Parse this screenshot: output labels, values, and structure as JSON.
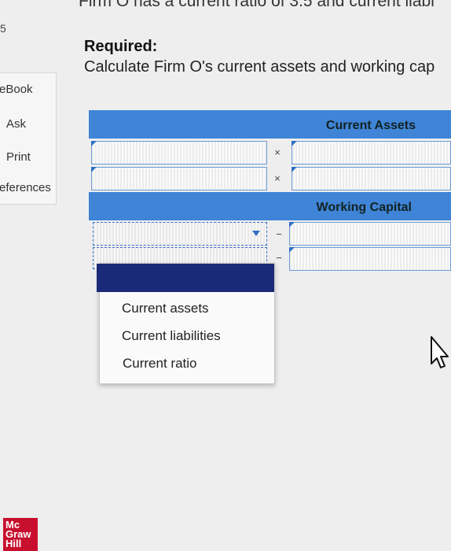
{
  "header": {
    "top_text": "Firm O has a current ratio of 3.5 and current liabi"
  },
  "nav": {
    "marker": "5",
    "items": [
      "eBook",
      "Ask",
      "Print",
      "eferences"
    ]
  },
  "content": {
    "required_label": "Required:",
    "question": "Calculate Firm O's current assets and working cap"
  },
  "table": {
    "current_assets_header": "Current Assets",
    "working_capital_header": "Working Capital",
    "operator_multiply": "×",
    "operator_minus": "−"
  },
  "dropdown": {
    "options": [
      "Current assets",
      "Current liabilities",
      "Current ratio"
    ]
  },
  "branding": {
    "logo_lines": [
      "Mc",
      "Graw",
      "Hill"
    ]
  },
  "colors": {
    "header_blue": "#3f84d6",
    "selected_navy": "#1a2a78",
    "logo_red": "#c8102e"
  }
}
